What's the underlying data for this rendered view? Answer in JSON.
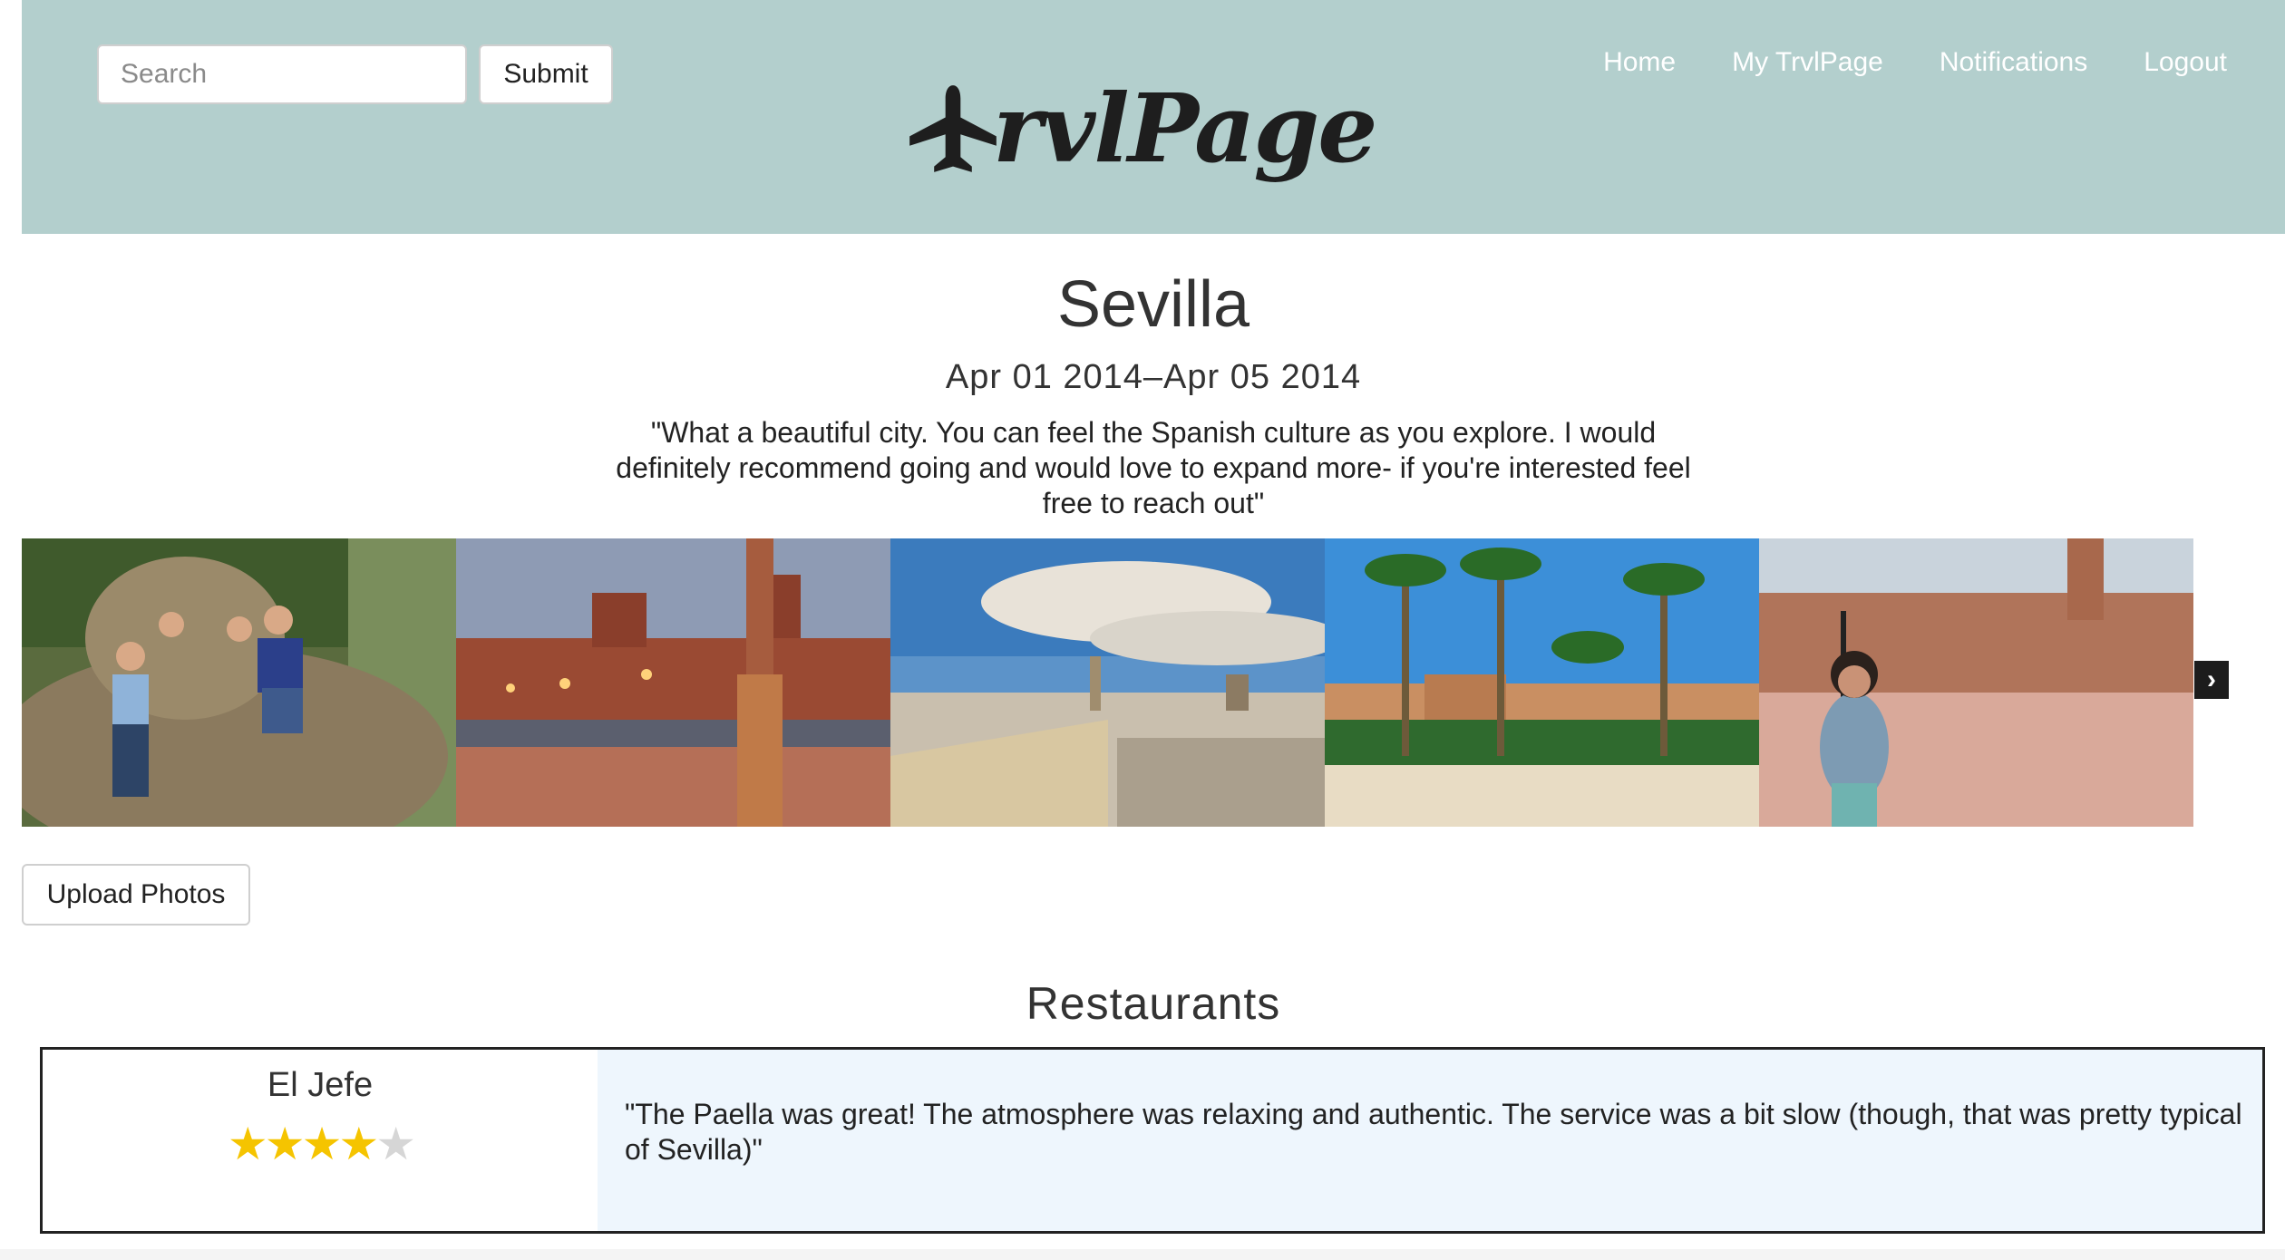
{
  "header": {
    "search_placeholder": "Search",
    "submit_label": "Submit",
    "logo_text": "rvlPage",
    "nav": [
      "Home",
      "My TrvlPage",
      "Notifications",
      "Logout"
    ]
  },
  "trip": {
    "title": "Sevilla",
    "dates": "Apr 01 2014–Apr 05 2014",
    "quote": "\"What a beautiful city. You can feel the Spanish culture as you explore. I would definitely recommend going and would love to expand more- if you're interested feel free to reach out\""
  },
  "carousel": {
    "next_glyph": "›",
    "photos": [
      "group-photo-on-rock",
      "plaza-de-espana-bridge-dusk",
      "city-skyline-view",
      "palm-trees-garden",
      "woman-at-plaza-de-espana"
    ]
  },
  "upload_label": "Upload Photos",
  "restaurants": {
    "title": "Restaurants",
    "items": [
      {
        "name": "El Jefe",
        "rating": 4,
        "max_rating": 5,
        "review": "\"The Paella was great! The atmosphere was relaxing and authentic. The service was a bit slow (though, that was pretty typical of Sevilla)\""
      }
    ]
  },
  "colors": {
    "header_bg": "#b3cfcd",
    "star_on": "#f5c400",
    "star_off": "#d6d6d6",
    "review_bg": "#eef6fd"
  }
}
